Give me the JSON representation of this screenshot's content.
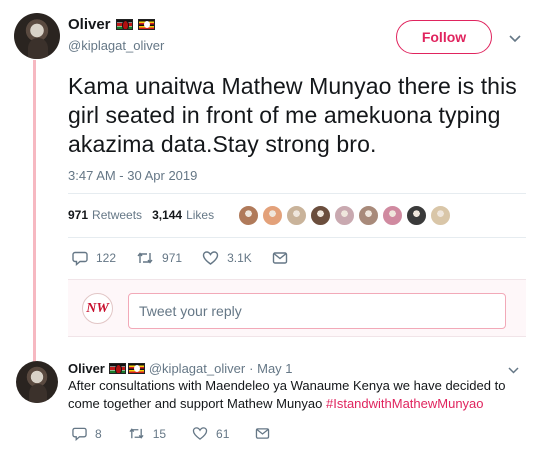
{
  "main_tweet": {
    "display_name": "Oliver",
    "handle": "@kiplagat_oliver",
    "follow_label": "Follow",
    "text": "Kama unaitwa Mathew Munyao there is this girl seated in front  of me amekuona typing akazima data.Stay strong bro.",
    "timestamp": "3:47 AM - 30 Apr 2019",
    "retweets_count": "971",
    "retweets_label": "Retweets",
    "likes_count": "3,144",
    "likes_label": "Likes",
    "actions": {
      "replies": "122",
      "retweets": "971",
      "likes": "3.1K"
    }
  },
  "likers": [
    "#b07a5a",
    "#e3a17a",
    "#c9b39a",
    "#6b4e3d",
    "#c9a9b0",
    "#a88a7a",
    "#d08aa0",
    "#3a3a3a",
    "#d9c6a8"
  ],
  "reply_box": {
    "logo_text": "NW",
    "placeholder": "Tweet your reply"
  },
  "reply_tweet": {
    "display_name": "Oliver",
    "handle": "@kiplagat_oliver",
    "date": "· May 1",
    "text": "After consultations with Maendeleo ya Wanaume Kenya we have decided to come together and support Mathew Munyao ",
    "hashtag": "#IstandwithMathewMunyao",
    "actions": {
      "replies": "8",
      "retweets": "15",
      "likes": "61"
    }
  },
  "colors": {
    "accent": "#e0245e",
    "muted": "#657786",
    "text": "#14171a",
    "thread_line": "#f6b8c1"
  },
  "icons": [
    "reply-icon",
    "retweet-icon",
    "heart-icon",
    "message-icon",
    "chevron-down-icon"
  ]
}
